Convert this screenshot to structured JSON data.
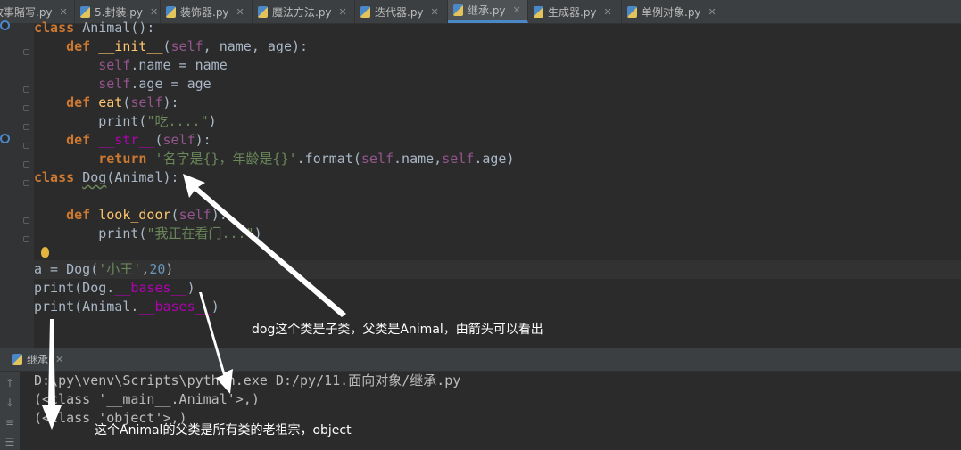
{
  "tabs": [
    {
      "label": "故事賭写.py",
      "active": false
    },
    {
      "label": "5.封装.py",
      "active": false
    },
    {
      "label": "装饰器.py",
      "active": false
    },
    {
      "label": "魔法方法.py",
      "active": false
    },
    {
      "label": "迭代器.py",
      "active": false
    },
    {
      "label": "继承.py",
      "active": true
    },
    {
      "label": "生成器.py",
      "active": false
    },
    {
      "label": "单例对象.py",
      "active": false
    }
  ],
  "code": {
    "l1_kw": "class",
    "l1_name": "Animal",
    "l1_rest": "():",
    "l2_kw": "def",
    "l2_fn": "__init__",
    "l2_open": "(",
    "l2_self": "self",
    "l2_rest": ", name, age):",
    "l3_self": "self",
    "l3_rest": ".name = name",
    "l4_self": "self",
    "l4_rest": ".age = age",
    "l5_kw": "def",
    "l5_fn": "eat",
    "l5_open": "(",
    "l5_self": "self",
    "l5_rest": "):",
    "l6_pre": "print(",
    "l6_str": "\"吃....\"",
    "l6_post": ")",
    "l7_kw": "def",
    "l7_fn": "__str__",
    "l7_open": "(",
    "l7_self": "self",
    "l7_rest": "):",
    "l8_kw": "return",
    "l8_str": "'名字是{}，年龄是{}'",
    "l8_mid": ".format(",
    "l8_self1": "self",
    "l8_mid2": ".name,",
    "l8_self2": "self",
    "l8_end": ".age)",
    "l9_kw": "class",
    "l9_name": "Dog",
    "l9_rest": "(Animal):",
    "l11_kw": "def",
    "l11_fn": "look_door",
    "l11_open": "(",
    "l11_self": "self",
    "l11_rest": "):",
    "l12_pre": "print(",
    "l12_str": "\"我正在看门...\"",
    "l12_post": ")",
    "l14_pre": "a = Dog(",
    "l14_str": "'小王'",
    "l14_comma": ",",
    "l14_num": "20",
    "l14_post": ")",
    "l15_pre": "print(Dog.",
    "l15_magic": "__bases__",
    "l15_post": ")",
    "l16_pre": "print(Animal.",
    "l16_magic": "__bases__",
    "l16_post": ")"
  },
  "annotations": {
    "a1": "dog这个类是子类，父类是Animal，由箭头可以看出",
    "a2": "这个Animal的父类是所有类的老祖宗，object"
  },
  "run_panel": {
    "tab_label": "继承",
    "line1": "D:\\py\\venv\\Scripts\\python.exe D:/py/11.面向对象/继承.py",
    "line2": "(<class '__main__.Animal'>,)",
    "line3": "(<class 'object'>,)"
  },
  "colors": {
    "background": "#2b2b2b",
    "keyword": "#cc7832",
    "function": "#ffc66d",
    "self": "#94558d",
    "string": "#6a8759",
    "number": "#6897bb",
    "magic": "#b200b2"
  }
}
